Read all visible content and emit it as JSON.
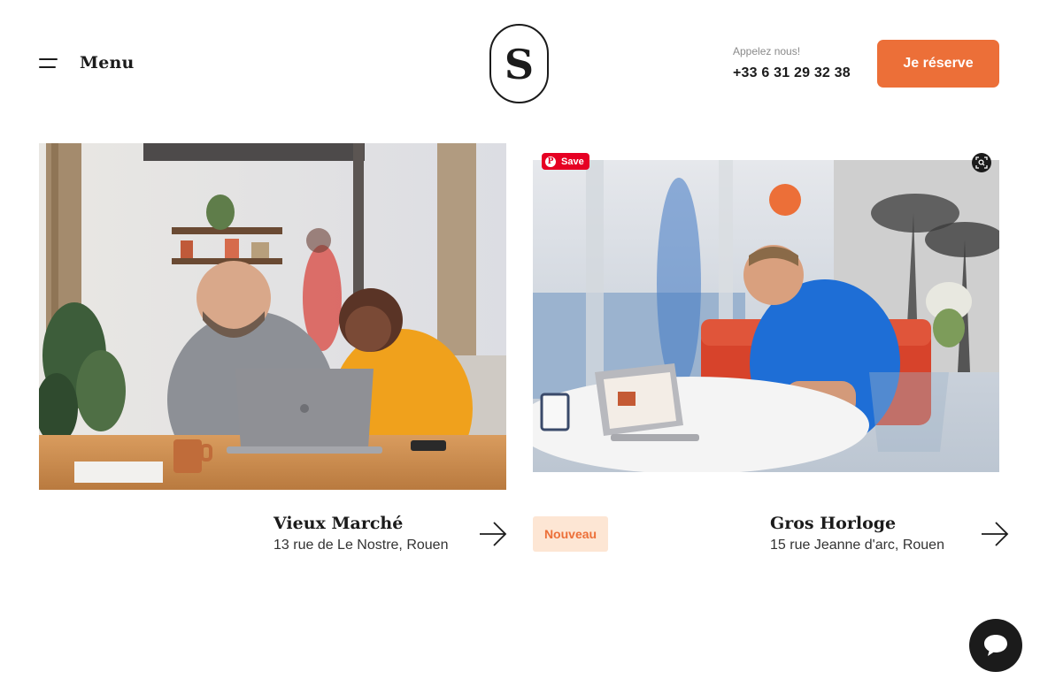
{
  "header": {
    "menu_label": "Menu",
    "logo_letter": "S",
    "call_label": "Appelez nous!",
    "phone": "+33 6 31 29 32 38",
    "reserve_label": "Je réserve"
  },
  "pinterest": {
    "save_label": "Save"
  },
  "locations": [
    {
      "name": "Vieux Marché",
      "address": "13 rue de Le Nostre, Rouen",
      "badge": ""
    },
    {
      "name": "Gros Horloge",
      "address": "15 rue Jeanne d'arc, Rouen",
      "badge": "Nouveau"
    }
  ],
  "colors": {
    "accent": "#ec6f38",
    "badge_bg": "#fde6d4",
    "text": "#1b1b1b",
    "muted": "#8a8a8a",
    "pinterest": "#e60023"
  },
  "icons": {
    "menu": "hamburger-icon",
    "arrow": "arrow-right-icon",
    "lens": "visual-search-icon",
    "chat": "chat-bubble-icon",
    "pinterest": "pinterest-icon"
  }
}
